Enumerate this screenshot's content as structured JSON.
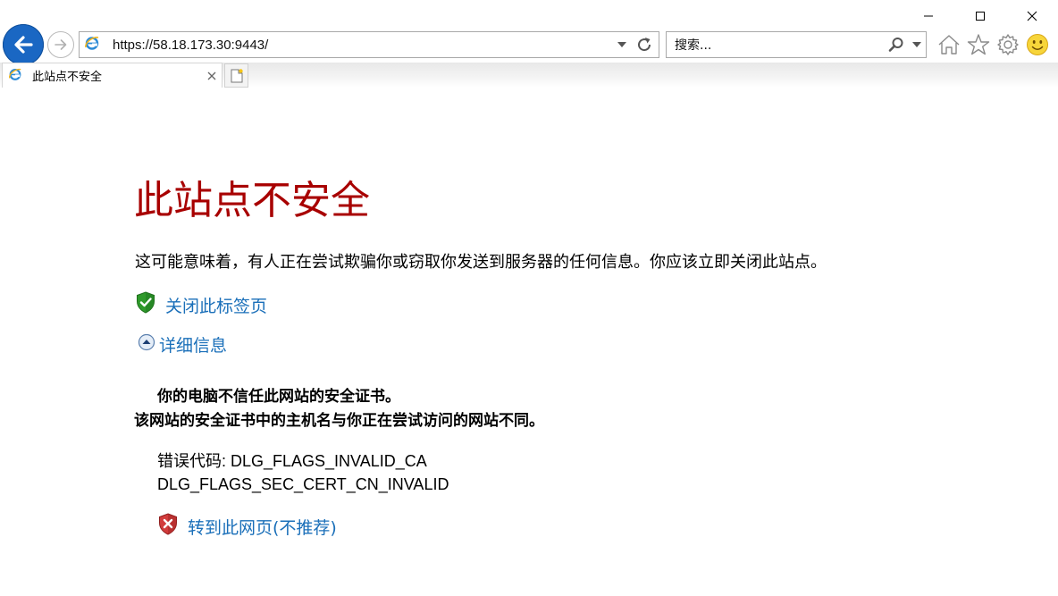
{
  "window": {
    "minimize_label": "minimize",
    "maximize_label": "maximize",
    "close_label": "close"
  },
  "nav": {
    "url": "https://58.18.173.30:9443/",
    "search_placeholder": "搜索...",
    "icons": {
      "back": "back-arrow-icon",
      "forward": "forward-arrow-icon",
      "refresh": "refresh-icon",
      "search": "search-icon",
      "home": "home-icon",
      "favorites": "star-icon",
      "settings": "gear-icon",
      "feedback": "smiley-icon"
    }
  },
  "tab": {
    "title": "此站点不安全"
  },
  "page": {
    "headline": "此站点不安全",
    "warning": "这可能意味着，有人正在尝试欺骗你或窃取你发送到服务器的任何信息。你应该立即关闭此站点。",
    "close_tab_link": "关闭此标签页",
    "details_link": "详细信息",
    "details_line1": "你的电脑不信任此网站的安全证书。",
    "details_line2": "该网站的安全证书中的主机名与你正在尝试访问的网站不同。",
    "error_code_line1": "错误代码: DLG_FLAGS_INVALID_CA",
    "error_code_line2": "DLG_FLAGS_SEC_CERT_CN_INVALID",
    "proceed_link": "转到此网页(不推荐)"
  },
  "colors": {
    "headline": "#a80000",
    "link": "#1a6fb9",
    "back_button": "#1a67c3"
  }
}
